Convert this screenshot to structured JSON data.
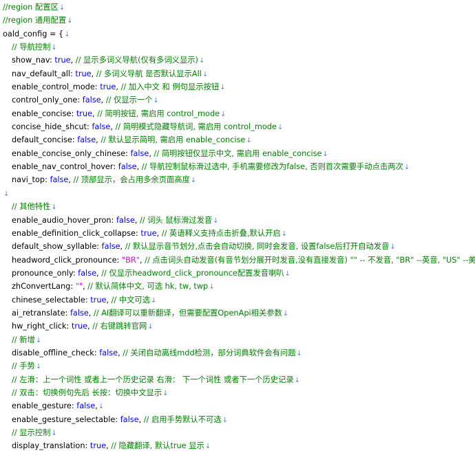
{
  "lines": [
    {
      "indent": false,
      "parts": [
        {
          "t": "c",
          "v": "//region 配置区"
        }
      ]
    },
    {
      "indent": false,
      "parts": [
        {
          "t": "c",
          "v": "//region 通用配置"
        }
      ]
    },
    {
      "indent": false,
      "parts": [
        {
          "t": "p",
          "v": "oald_config = {"
        }
      ]
    },
    {
      "indent": true,
      "parts": [
        {
          "t": "c",
          "v": "// 导航控制"
        }
      ]
    },
    {
      "indent": true,
      "parts": [
        {
          "t": "p",
          "v": "show_nav: "
        },
        {
          "t": "k",
          "v": "true"
        },
        {
          "t": "p",
          "v": ", "
        },
        {
          "t": "c",
          "v": "// 显示多词义导航(仅有多词义显示)"
        }
      ]
    },
    {
      "indent": true,
      "parts": [
        {
          "t": "p",
          "v": "nav_default_all: "
        },
        {
          "t": "k",
          "v": "true"
        },
        {
          "t": "p",
          "v": ", "
        },
        {
          "t": "c",
          "v": "// 多词义导航 是否默认显示All"
        }
      ]
    },
    {
      "indent": true,
      "parts": [
        {
          "t": "p",
          "v": "enable_control_mode: "
        },
        {
          "t": "k",
          "v": "true"
        },
        {
          "t": "p",
          "v": ", "
        },
        {
          "t": "c",
          "v": "// 加入中文 和 例句显示按钮"
        }
      ]
    },
    {
      "indent": true,
      "parts": [
        {
          "t": "p",
          "v": "control_only_one: "
        },
        {
          "t": "k",
          "v": "false"
        },
        {
          "t": "p",
          "v": ", "
        },
        {
          "t": "c",
          "v": "// 仅显示一个"
        }
      ]
    },
    {
      "indent": true,
      "parts": [
        {
          "t": "p",
          "v": "enable_concise: "
        },
        {
          "t": "k",
          "v": "true"
        },
        {
          "t": "p",
          "v": ", "
        },
        {
          "t": "c",
          "v": "// 简明按钮, 需启用 control_mode"
        }
      ]
    },
    {
      "indent": true,
      "parts": [
        {
          "t": "p",
          "v": "concise_hide_shcut: "
        },
        {
          "t": "k",
          "v": "false"
        },
        {
          "t": "p",
          "v": ", "
        },
        {
          "t": "c",
          "v": "// 简明模式隐藏导航词, 需启用 control_mode"
        }
      ]
    },
    {
      "indent": true,
      "parts": [
        {
          "t": "p",
          "v": "default_concise: "
        },
        {
          "t": "k",
          "v": "false"
        },
        {
          "t": "p",
          "v": ", "
        },
        {
          "t": "c",
          "v": "// 默认显示简明, 需启用 enable_concise"
        }
      ]
    },
    {
      "indent": true,
      "parts": [
        {
          "t": "p",
          "v": "enable_concise_only_chinese: "
        },
        {
          "t": "k",
          "v": "false"
        },
        {
          "t": "p",
          "v": ", "
        },
        {
          "t": "c",
          "v": "// 简明按钮仅显示中文, 需启用 enable_concise"
        }
      ]
    },
    {
      "indent": true,
      "parts": [
        {
          "t": "p",
          "v": "enable_nav_control_hover: "
        },
        {
          "t": "k",
          "v": "false"
        },
        {
          "t": "p",
          "v": ", "
        },
        {
          "t": "c",
          "v": "// 导航控制鼠标滑过选中, 手机需要修改为false, 否则首次需要手动点击两次"
        }
      ]
    },
    {
      "indent": true,
      "parts": [
        {
          "t": "p",
          "v": "navi_top: "
        },
        {
          "t": "k",
          "v": "false"
        },
        {
          "t": "p",
          "v": ", "
        },
        {
          "t": "c",
          "v": "// 顶部显示，会占用多余页面高度"
        }
      ]
    },
    {
      "indent": false,
      "parts": []
    },
    {
      "indent": true,
      "parts": [
        {
          "t": "c",
          "v": "// 其他特性"
        }
      ]
    },
    {
      "indent": true,
      "parts": [
        {
          "t": "p",
          "v": "enable_audio_hover_pron: "
        },
        {
          "t": "k",
          "v": "false"
        },
        {
          "t": "p",
          "v": ", "
        },
        {
          "t": "c",
          "v": "// 词头 鼠标滑过发音"
        }
      ]
    },
    {
      "indent": true,
      "parts": [
        {
          "t": "p",
          "v": "enable_definition_click_collapse: "
        },
        {
          "t": "k",
          "v": "true"
        },
        {
          "t": "p",
          "v": ", "
        },
        {
          "t": "c",
          "v": "// 英语释义支持点击折叠,默认开启"
        }
      ]
    },
    {
      "indent": true,
      "parts": [
        {
          "t": "p",
          "v": "default_show_syllable: "
        },
        {
          "t": "k",
          "v": "false"
        },
        {
          "t": "p",
          "v": ", "
        },
        {
          "t": "c",
          "v": "// 默认显示音节划分,点击会自动切换, 同时会发音, 设置false后打开自动发音"
        }
      ]
    },
    {
      "indent": true,
      "parts": [
        {
          "t": "p",
          "v": "headword_click_pronounce: "
        },
        {
          "t": "s",
          "v": "\"BR\""
        },
        {
          "t": "p",
          "v": ", "
        },
        {
          "t": "c",
          "v": "// 点击词头自动发音(有音节划分展开时发音,没有直接发音)    \"\" -- 不发音, \"BR\" --英音, \"US\" --美音"
        }
      ]
    },
    {
      "indent": true,
      "parts": [
        {
          "t": "p",
          "v": "pronounce_only: "
        },
        {
          "t": "k",
          "v": "false"
        },
        {
          "t": "p",
          "v": ", "
        },
        {
          "t": "c",
          "v": "// 仅显示headword_click_pronounce配置发音喇叭"
        }
      ]
    },
    {
      "indent": true,
      "parts": [
        {
          "t": "p",
          "v": "zhConvertLang: "
        },
        {
          "t": "s",
          "v": "\"\""
        },
        {
          "t": "p",
          "v": ", "
        },
        {
          "t": "c",
          "v": "// 默认简体中文, 可选 hk, tw, twp"
        }
      ]
    },
    {
      "indent": true,
      "parts": [
        {
          "t": "p",
          "v": "chinese_selectable: "
        },
        {
          "t": "k",
          "v": "true"
        },
        {
          "t": "p",
          "v": ", "
        },
        {
          "t": "c",
          "v": "// 中文可选"
        }
      ]
    },
    {
      "indent": true,
      "parts": [
        {
          "t": "p",
          "v": "ai_retranslate: "
        },
        {
          "t": "k",
          "v": "false"
        },
        {
          "t": "p",
          "v": ", "
        },
        {
          "t": "c",
          "v": "// AI翻译可以重新翻译，但需要配置OpenApi相关参数"
        }
      ]
    },
    {
      "indent": true,
      "parts": [
        {
          "t": "p",
          "v": "hw_right_click: "
        },
        {
          "t": "k",
          "v": "true"
        },
        {
          "t": "p",
          "v": ", "
        },
        {
          "t": "c",
          "v": "// 右键跳转官网"
        }
      ]
    },
    {
      "indent": true,
      "parts": [
        {
          "t": "c",
          "v": "// 新增"
        }
      ]
    },
    {
      "indent": true,
      "parts": [
        {
          "t": "p",
          "v": "disable_offline_check: "
        },
        {
          "t": "k",
          "v": "false"
        },
        {
          "t": "p",
          "v": ", "
        },
        {
          "t": "c",
          "v": "// 关闭自动离线mdd检测，部分词典软件会有问题"
        }
      ]
    },
    {
      "indent": true,
      "parts": [
        {
          "t": "c",
          "v": "// 手势"
        }
      ]
    },
    {
      "indent": true,
      "parts": [
        {
          "t": "c",
          "v": "// 左滑：上一个词性  或者上一个历史记录 右滑：  下一个词性 或者下一个历史记录"
        }
      ]
    },
    {
      "indent": true,
      "parts": [
        {
          "t": "c",
          "v": "// 双击：切换例句先后      长按：切换中文显示"
        }
      ]
    },
    {
      "indent": true,
      "parts": [
        {
          "t": "p",
          "v": "enable_gesture: "
        },
        {
          "t": "k",
          "v": "false"
        },
        {
          "t": "p",
          "v": ","
        }
      ]
    },
    {
      "indent": true,
      "parts": [
        {
          "t": "p",
          "v": "enable_gesture_selectable: "
        },
        {
          "t": "k",
          "v": "false"
        },
        {
          "t": "p",
          "v": ", "
        },
        {
          "t": "c",
          "v": "// 启用手势默认不可选"
        }
      ]
    },
    {
      "indent": true,
      "parts": [
        {
          "t": "c",
          "v": "// 显示控制"
        }
      ]
    },
    {
      "indent": true,
      "parts": [
        {
          "t": "p",
          "v": "display_translation: "
        },
        {
          "t": "k",
          "v": "true"
        },
        {
          "t": "p",
          "v": ", "
        },
        {
          "t": "c",
          "v": "// 隐藏翻译, 默认true 显示"
        }
      ]
    }
  ]
}
